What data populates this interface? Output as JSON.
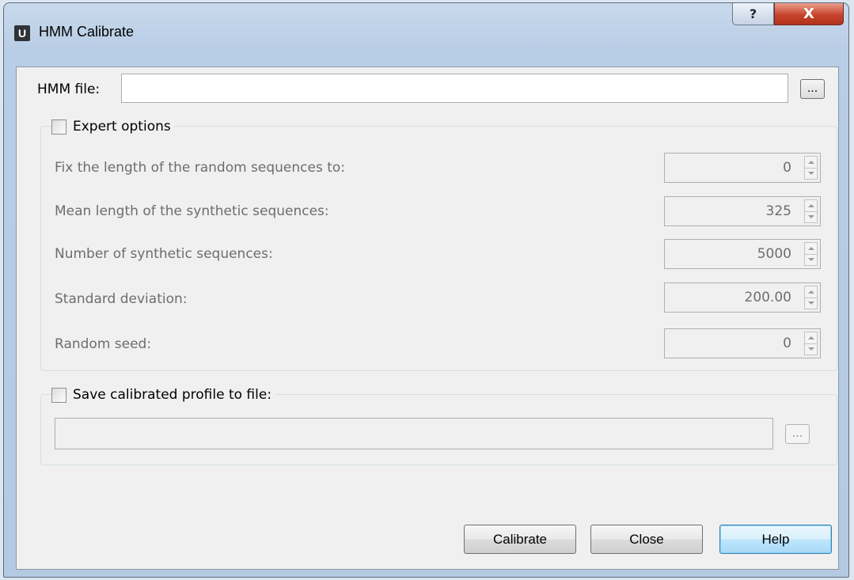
{
  "window": {
    "app_icon_letter": "U",
    "title": "HMM Calibrate",
    "help_glyph": "?",
    "close_glyph": "X"
  },
  "hmm_file": {
    "label": "HMM file:",
    "value": "",
    "browse_label": "..."
  },
  "expert_options": {
    "label": "Expert options",
    "checked": false,
    "fields": [
      {
        "label": "Fix the length of the random sequences to:",
        "value": "0"
      },
      {
        "label": "Mean length of the synthetic sequences:",
        "value": "325"
      },
      {
        "label": "Number of synthetic sequences:",
        "value": "5000"
      },
      {
        "label": "Standard deviation:",
        "value": "200.00"
      },
      {
        "label": "Random seed:",
        "value": "0"
      }
    ]
  },
  "save_profile": {
    "label": "Save calibrated profile to file:",
    "checked": false,
    "value": "",
    "browse_label": "..."
  },
  "buttons": {
    "calibrate": "Calibrate",
    "close": "Close",
    "help": "Help"
  }
}
